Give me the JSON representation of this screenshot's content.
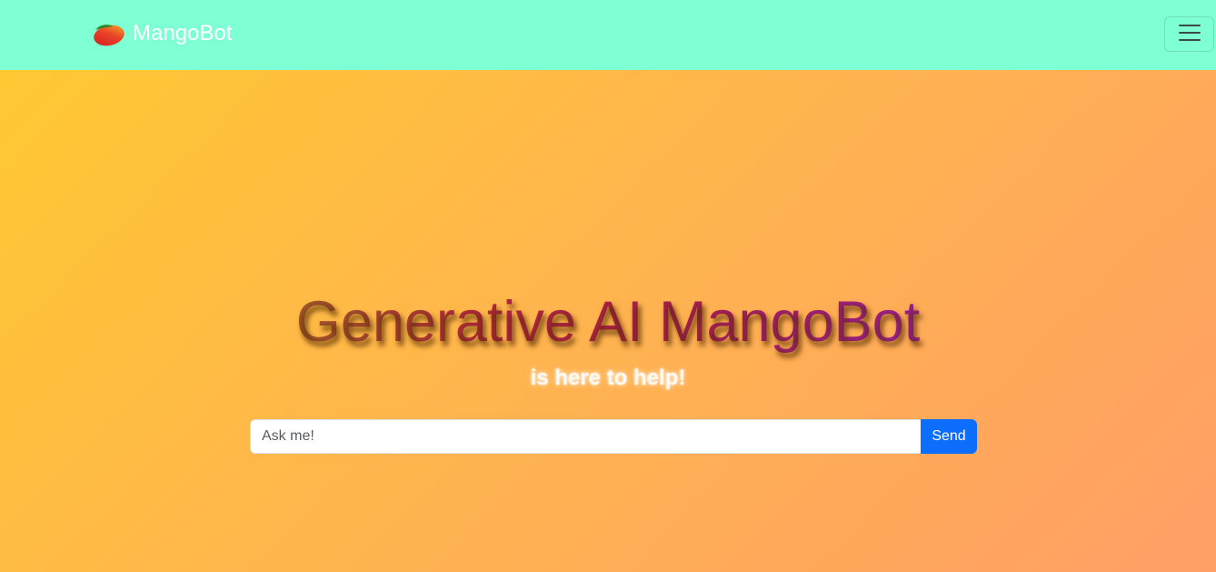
{
  "navbar": {
    "brand_text": "MangoBot",
    "logo_icon": "mango-icon",
    "menu_icon": "hamburger-menu-icon",
    "background_color": "#7fffd4"
  },
  "hero": {
    "title": "Generative AI MangoBot",
    "subtitle": "is here to help!",
    "gradient_colors": [
      "#ffc832",
      "#ff9f66"
    ]
  },
  "search": {
    "placeholder": "Ask me!",
    "value": "",
    "send_label": "Send",
    "send_color": "#0d6efd"
  }
}
